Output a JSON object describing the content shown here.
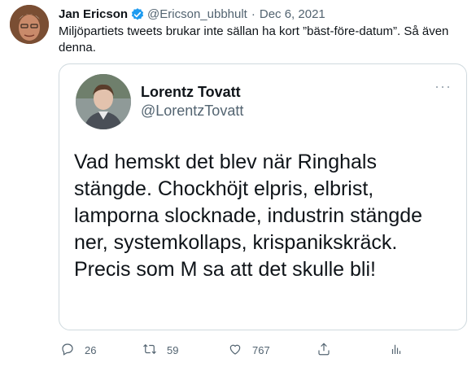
{
  "tweet": {
    "author_name": "Jan Ericson",
    "author_handle": "@Ericson_ubbhult",
    "separator": "·",
    "date": "Dec 6, 2021",
    "text": "Miljöpartiets tweets brukar inte sällan ha kort ”bäst-före-datum”. Så även denna."
  },
  "quoted": {
    "name": "Lorentz Tovatt",
    "handle": "@LorentzTovatt",
    "more": "···",
    "text": "Vad hemskt det blev när Ringhals stängde. Chockhöjt elpris, elbrist, lamporna slocknade, industrin stängde ner, systemkollaps, krispanikskräck. Precis som M sa att det skulle bli!"
  },
  "actions": {
    "reply_count": "26",
    "retweet_count": "59",
    "like_count": "767"
  },
  "colors": {
    "verified": "#1d9bf0",
    "text": "#0f1419",
    "muted": "#536471",
    "border": "#cfd9de"
  },
  "icons": [
    "verified-badge-icon",
    "reply-icon",
    "retweet-icon",
    "like-icon",
    "share-icon",
    "analytics-icon",
    "more-icon"
  ]
}
